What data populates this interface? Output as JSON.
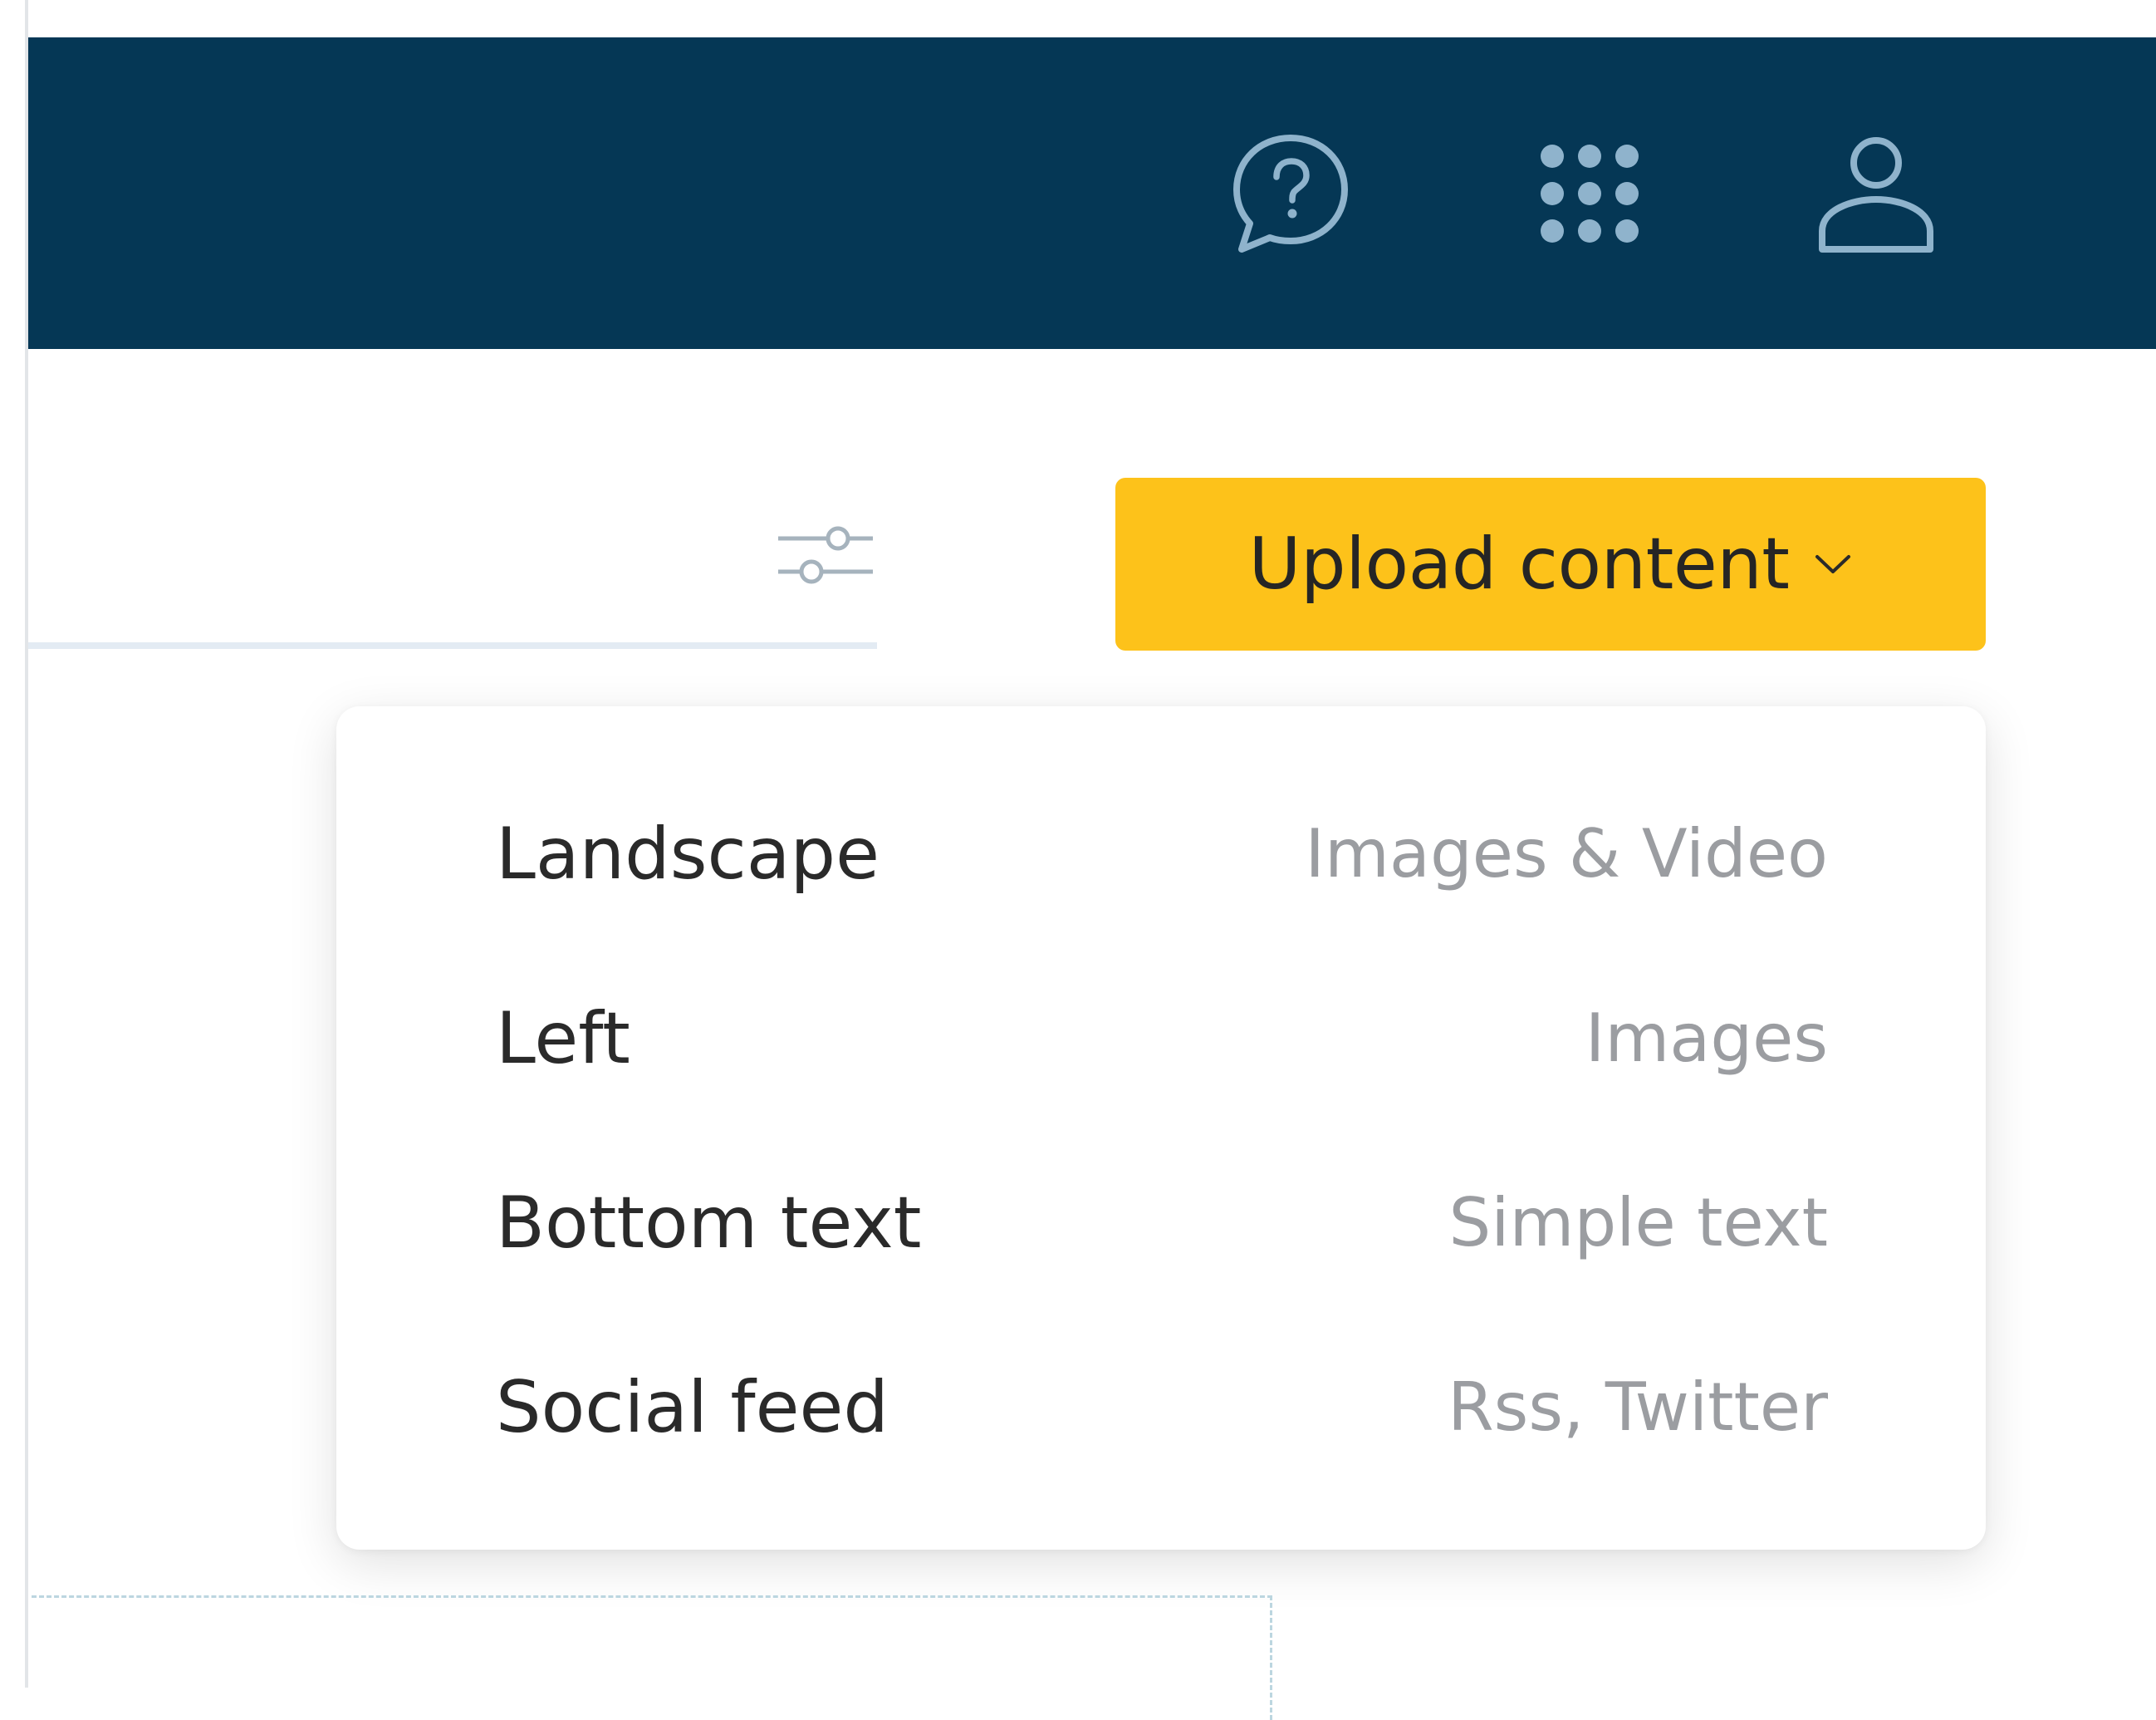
{
  "topbar": {
    "background": "#053755",
    "icons": [
      "help-icon",
      "apps-grid-icon",
      "user-icon"
    ]
  },
  "filter": {
    "icon": "filter-sliders-icon"
  },
  "upload_button": {
    "label": "Upload content",
    "caret_icon": "chevron-down-icon",
    "color": "#fdc21a"
  },
  "dropdown": {
    "items": [
      {
        "name": "Landscape",
        "type": "Images & Video"
      },
      {
        "name": "Left",
        "type": "Images"
      },
      {
        "name": "Bottom text",
        "type": "Simple text"
      },
      {
        "name": "Social feed",
        "type": "Rss, Twitter"
      }
    ]
  }
}
